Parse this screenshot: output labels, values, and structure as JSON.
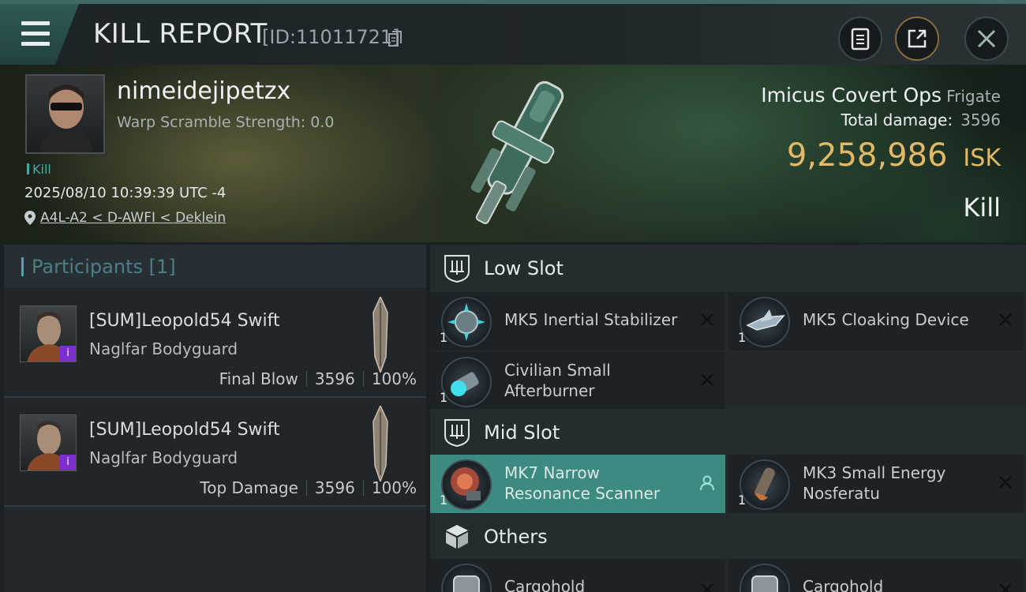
{
  "header": {
    "title": "KILL REPORT",
    "id_label": "[ID:11011721]"
  },
  "victim": {
    "name": "nimeidejipetzx",
    "scramble": "Warp Scramble Strength: 0.0",
    "kill_tag": "Kill",
    "datetime": "2025/08/10 10:39:39 UTC -4",
    "location": "A4L-A2 < D-AWFI < Deklein",
    "ship_name": "Imicus Covert Ops",
    "ship_class": "Frigate",
    "total_damage_label": "Total damage:",
    "total_damage_value": "3596",
    "isk_value": "9,258,986",
    "isk_unit": "ISK",
    "result": "Kill"
  },
  "participants": {
    "title": "Participants",
    "count": "[1]",
    "rows": [
      {
        "name": "[SUM]Leopold54 Swift",
        "ship": "Naglfar Bodyguard",
        "label": "Final Blow",
        "damage": "3596",
        "percent": "100%",
        "badge": "i"
      },
      {
        "name": "[SUM]Leopold54 Swift",
        "ship": "Naglfar Bodyguard",
        "label": "Top Damage",
        "damage": "3596",
        "percent": "100%",
        "badge": "i"
      }
    ]
  },
  "fitting": {
    "low_slot": {
      "label": "Low Slot",
      "modules": [
        {
          "qty": "1",
          "name": "MK5 Inertial Stabilizer"
        },
        {
          "qty": "1",
          "name": "MK5 Cloaking Device"
        },
        {
          "qty": "1",
          "name_line1": "Civilian Small",
          "name_line2": "Afterburner"
        }
      ]
    },
    "mid_slot": {
      "label": "Mid Slot",
      "modules": [
        {
          "qty": "1",
          "name_line1": "MK7 Narrow",
          "name_line2": "Resonance Scanner"
        },
        {
          "qty": "1",
          "name_line1": "MK3 Small Energy",
          "name_line2": "Nosferatu"
        }
      ]
    },
    "others": {
      "label": "Others",
      "modules": [
        {
          "name": "Cargohold"
        },
        {
          "name": "Cargohold"
        }
      ]
    }
  },
  "colors": {
    "accent_teal": "#47a9b0",
    "isk_gold": "#e3b867",
    "active_module": "#3c8a80",
    "badge_purple": "#7b2fd0"
  },
  "icons": [
    "menu-icon",
    "copy-icon",
    "clipboard-icon",
    "share-icon",
    "close-icon",
    "pin-icon",
    "slot-icon",
    "box-icon",
    "remove-icon",
    "person-icon"
  ]
}
